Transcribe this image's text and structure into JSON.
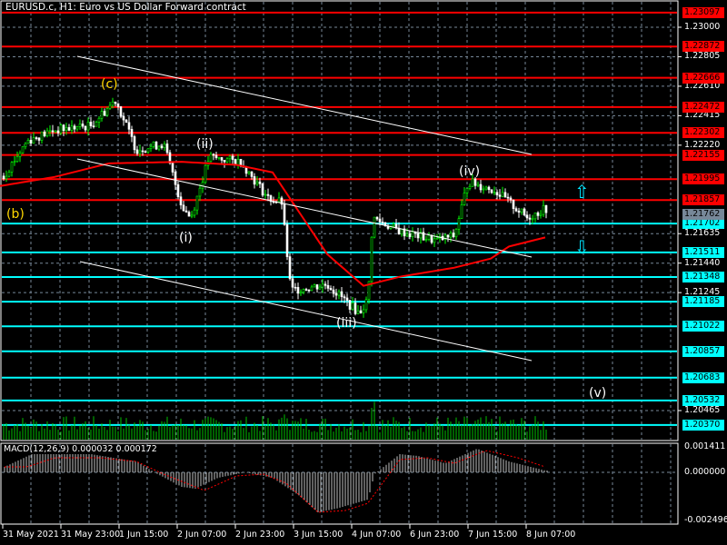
{
  "header": {
    "title": "EURUSD.c, H1:  Euro vs US Dollar Forward contract"
  },
  "macd": {
    "title": "MACD(12,26,9) 0.000032 0.000172",
    "ticks": [
      "0.001411",
      "0.000000",
      "-0.002496"
    ]
  },
  "price_ticks": [
    "1.23000",
    "1.22805",
    "1.22610",
    "1.22415",
    "1.22220",
    "1.21440",
    "1.21635",
    "1.21245",
    "1.20465"
  ],
  "red_levels": [
    "1.23097",
    "1.22872",
    "1.22666",
    "1.22472",
    "1.22302",
    "1.22155",
    "1.21995",
    "1.21857"
  ],
  "current_price": "1.21762",
  "cyan_levels": [
    "1.21702",
    "1.21511",
    "1.21348",
    "1.21185",
    "1.21022",
    "1.20857",
    "1.20683",
    "1.20532",
    "1.20370"
  ],
  "time_axis": [
    "31 May 2021",
    "31 May 23:00",
    "1 Jun 15:00",
    "2 Jun 07:00",
    "2 Jun 23:00",
    "3 Jun 15:00",
    "4 Jun 07:00",
    "6 Jun 23:00",
    "7 Jun 15:00",
    "8 Jun 07:00"
  ],
  "wave_labels": {
    "c": "(c)",
    "b": "(b)",
    "ii": "(ii)",
    "i": "(i)",
    "iii": "(iii)",
    "iv": "(iv)",
    "v": "(v)"
  },
  "arrows": {
    "up": "⇧",
    "down": "⇩"
  },
  "colors": {
    "bg": "#000000",
    "up": "#00ff00",
    "down": "#ffffff",
    "ma": "#ff0000",
    "red_level": "#ff0000",
    "cyan_level": "#00ffff",
    "grid": "#778899"
  },
  "chart_data": {
    "type": "candlestick",
    "symbol": "EURUSD.c",
    "timeframe": "H1",
    "ylim": [
      1.2037,
      1.231
    ],
    "price_path": [
      [
        0,
        1.2198
      ],
      [
        30,
        1.2225
      ],
      [
        60,
        1.2232
      ],
      [
        100,
        1.2235
      ],
      [
        127,
        1.2252
      ],
      [
        150,
        1.2219
      ],
      [
        180,
        1.2223
      ],
      [
        200,
        1.2182
      ],
      [
        210,
        1.2174
      ],
      [
        230,
        1.2214
      ],
      [
        265,
        1.2211
      ],
      [
        295,
        1.2187
      ],
      [
        310,
        1.2184
      ],
      [
        320,
        1.2126
      ],
      [
        360,
        1.213
      ],
      [
        395,
        1.2111
      ],
      [
        405,
        1.212
      ],
      [
        410,
        1.2174
      ],
      [
        440,
        1.2165
      ],
      [
        480,
        1.2159
      ],
      [
        500,
        1.2162
      ],
      [
        515,
        1.2198
      ],
      [
        545,
        1.2192
      ],
      [
        580,
        1.2174
      ],
      [
        600,
        1.218
      ]
    ],
    "moving_average": [
      [
        0,
        1.2195
      ],
      [
        60,
        1.2201
      ],
      [
        120,
        1.221
      ],
      [
        200,
        1.2211
      ],
      [
        260,
        1.2209
      ],
      [
        300,
        1.2204
      ],
      [
        320,
        1.2186
      ],
      [
        360,
        1.215
      ],
      [
        400,
        1.2129
      ],
      [
        440,
        1.2135
      ],
      [
        500,
        1.2141
      ],
      [
        540,
        1.2147
      ],
      [
        560,
        1.2155
      ],
      [
        600,
        1.2161
      ]
    ],
    "macd_hist": [
      [
        5,
        0.0003
      ],
      [
        35,
        0.001
      ],
      [
        100,
        0.001
      ],
      [
        150,
        0.0006
      ],
      [
        170,
        0
      ],
      [
        200,
        -0.0008
      ],
      [
        215,
        -0.0009
      ],
      [
        240,
        -0.0003
      ],
      [
        270,
        0
      ],
      [
        300,
        -0.0003
      ],
      [
        330,
        -0.0013
      ],
      [
        350,
        -0.0022
      ],
      [
        370,
        -0.002
      ],
      [
        405,
        -0.0015
      ],
      [
        412,
        -0.0001
      ],
      [
        440,
        0.001
      ],
      [
        460,
        0.0009
      ],
      [
        490,
        0.0005
      ],
      [
        525,
        0.0013
      ],
      [
        560,
        0.0006
      ],
      [
        600,
        0.0001
      ]
    ],
    "macd_signal": [
      [
        5,
        0.0003
      ],
      [
        30,
        0.0003
      ],
      [
        60,
        0.0008
      ],
      [
        110,
        0.0008
      ],
      [
        150,
        0.0006
      ],
      [
        180,
        -0.0001
      ],
      [
        225,
        -0.001
      ],
      [
        260,
        -0.0002
      ],
      [
        290,
        -0.0001
      ],
      [
        315,
        -0.0006
      ],
      [
        350,
        -0.0022
      ],
      [
        380,
        -0.0021
      ],
      [
        405,
        -0.0017
      ],
      [
        415,
        -0.001
      ],
      [
        440,
        0.0007
      ],
      [
        470,
        0.0008
      ],
      [
        500,
        0.0005
      ],
      [
        535,
        0.0012
      ],
      [
        570,
        0.0008
      ],
      [
        600,
        0.0003
      ]
    ]
  }
}
